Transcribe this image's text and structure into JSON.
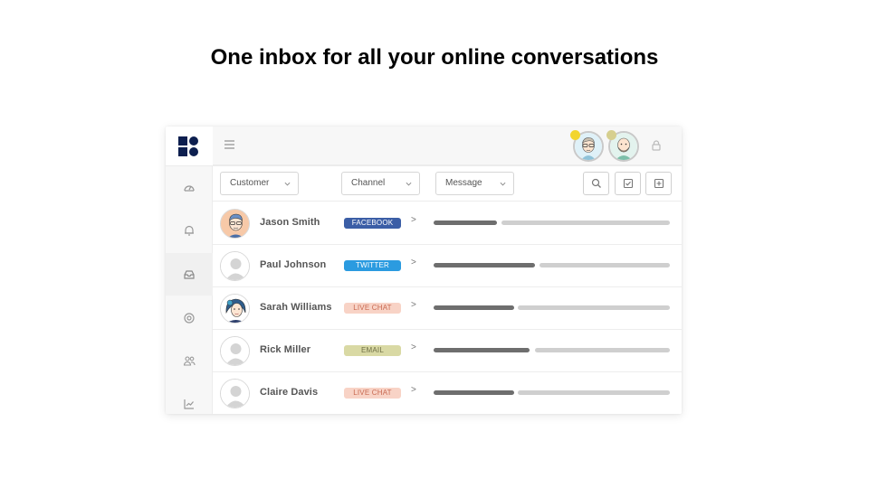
{
  "headline": "One inbox for all your online conversations",
  "filters": {
    "customer": "Customer",
    "channel": "Channel",
    "message": "Message"
  },
  "rows": [
    {
      "name": "Jason Smith",
      "channel": "FACEBOOK",
      "channel_bg": "#3b5ea6",
      "channel_fg": "#ffffff",
      "arrow": ">"
    },
    {
      "name": "Paul Johnson",
      "channel": "TWITTER",
      "channel_bg": "#2b9be0",
      "channel_fg": "#ffffff",
      "arrow": ">"
    },
    {
      "name": "Sarah Williams",
      "channel": "LIVE CHAT",
      "channel_bg": "#f8d3c6",
      "channel_fg": "#c86a52",
      "arrow": ">"
    },
    {
      "name": "Rick Miller",
      "channel": "EMAIL",
      "channel_bg": "#d9d9a4",
      "channel_fg": "#6f6f45",
      "arrow": ">"
    },
    {
      "name": "Claire Davis",
      "channel": "LIVE CHAT",
      "channel_bg": "#f8d3c6",
      "channel_fg": "#c86a52",
      "arrow": ">"
    }
  ],
  "icons": {
    "sidebar": [
      "dashboard-icon",
      "bell-icon",
      "inbox-icon",
      "target-icon",
      "users-icon",
      "analytics-icon"
    ],
    "toolbar": [
      "search-icon",
      "checkbox-icon",
      "add-icon"
    ],
    "topbar": [
      "menu-icon",
      "lock-icon"
    ]
  },
  "colors": {
    "brand": "#0d1f4f",
    "status_online": "#f2d52e",
    "status_away": "#d6cf8e"
  }
}
